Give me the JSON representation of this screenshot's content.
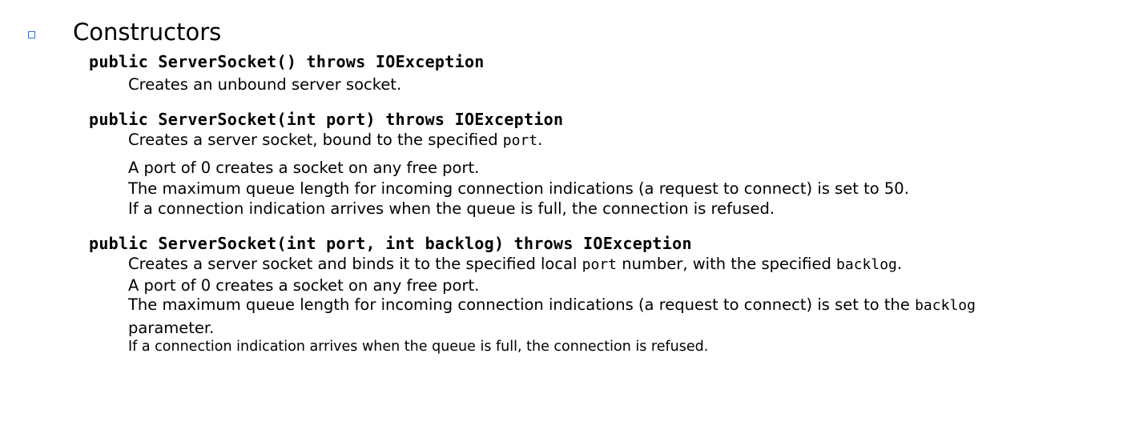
{
  "section": {
    "heading": "Constructors"
  },
  "constructors": [
    {
      "signature": "public ServerSocket() throws IOException",
      "description": "Creates an unbound server socket."
    },
    {
      "signature": "public ServerSocket(int port) throws IOException",
      "line1": {
        "text": "Creates a server socket, bound to the specified ",
        "code": "port",
        "end": "."
      },
      "line2": "A port of 0 creates a socket on any free port.",
      "line3": "The maximum queue length for incoming connection indications (a request to connect) is set to 50.",
      "line4": "If a connection indication arrives when the queue is full, the connection is refused."
    },
    {
      "signature": "public ServerSocket(int port, int backlog) throws IOException",
      "line1": {
        "text_a": "Creates a server socket and binds it to the specified local ",
        "code_a": "port",
        "text_b": " number, with the specified ",
        "code_b": "backlog",
        "end": "."
      },
      "line2": "A port of 0 creates a socket on any free port.",
      "line3": {
        "text": "The maximum queue length for incoming connection indications (a request to connect) is set to the ",
        "code": "backlog"
      },
      "line4": "parameter.",
      "line5": "If a connection indication arrives when the queue is full, the connection is refused."
    }
  ]
}
